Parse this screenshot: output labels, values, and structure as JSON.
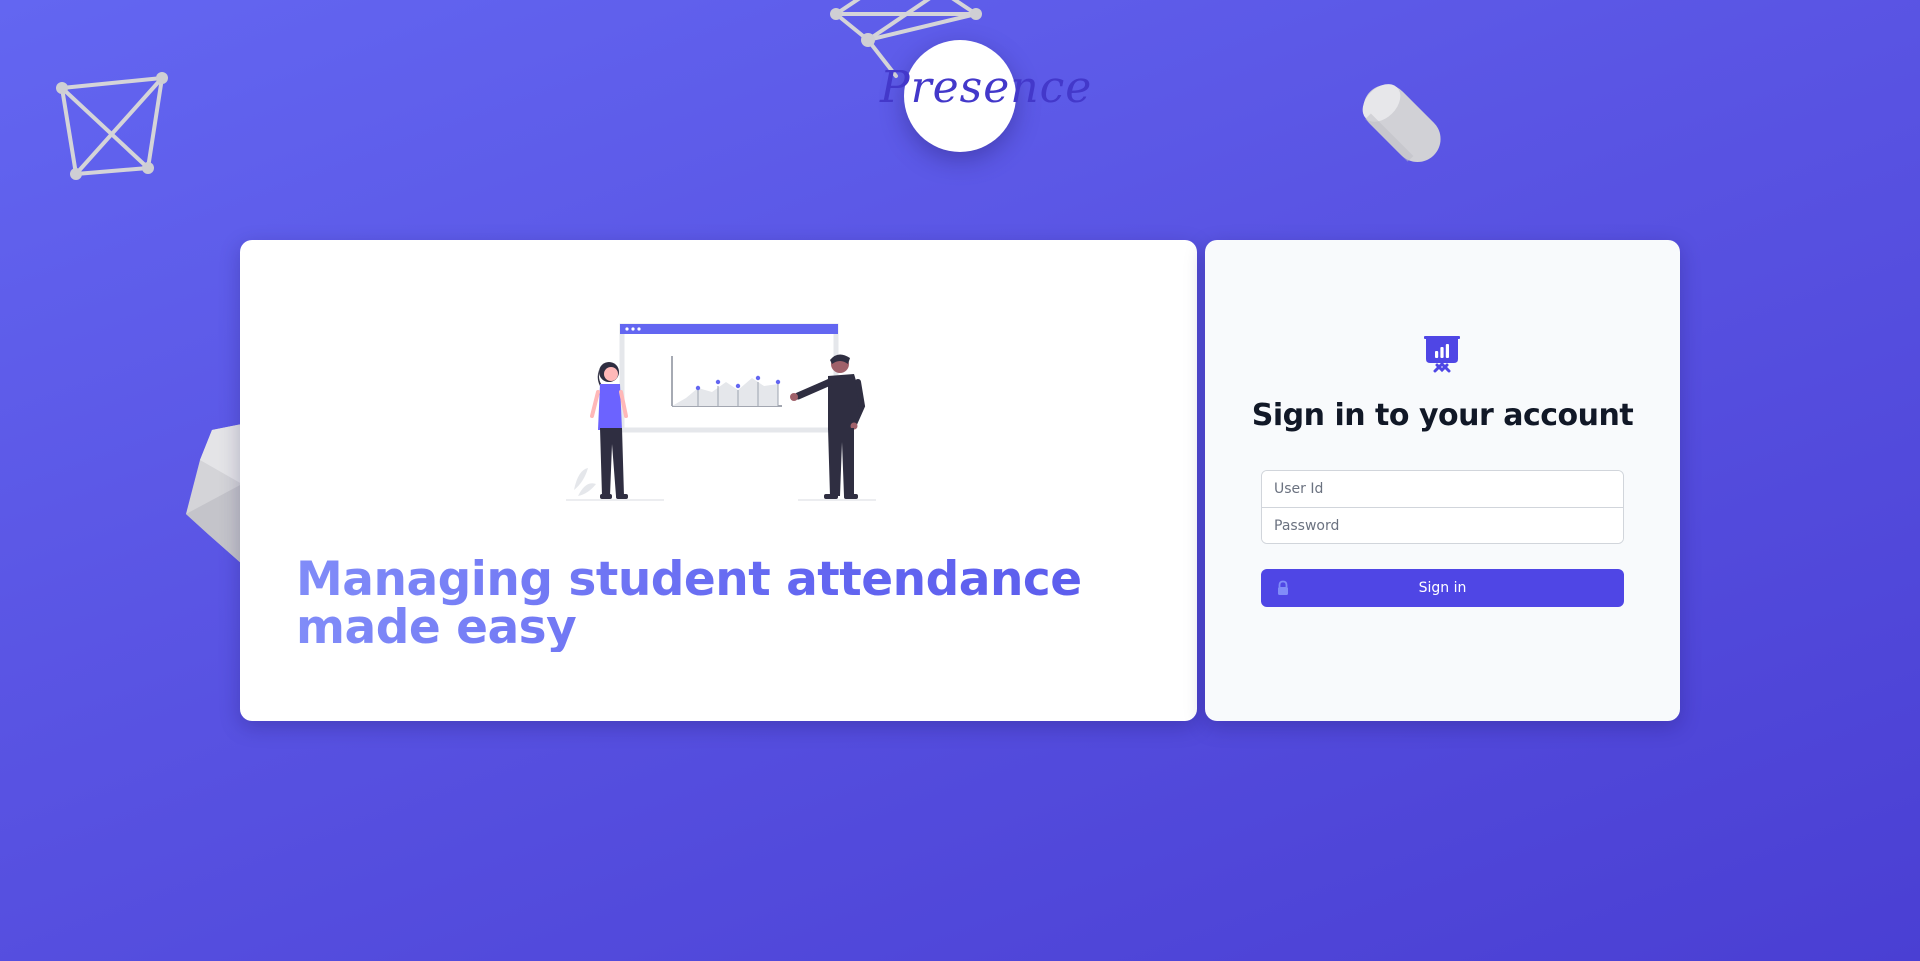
{
  "brand": {
    "logo_text": "Presence"
  },
  "hero": {
    "tagline": "Managing student attendance made easy",
    "illustration": "presentation-chart-illustration"
  },
  "signin": {
    "icon": "presentation-chart-icon",
    "title": "Sign in to your account",
    "user_id_placeholder": "User Id",
    "password_placeholder": "Password",
    "button_label": "Sign in",
    "button_icon": "lock-icon"
  },
  "colors": {
    "background_start": "#6366f1",
    "background_end": "#4a3fd3",
    "accent": "#4f46e5",
    "tagline": "#6366f1",
    "title": "#111827"
  }
}
